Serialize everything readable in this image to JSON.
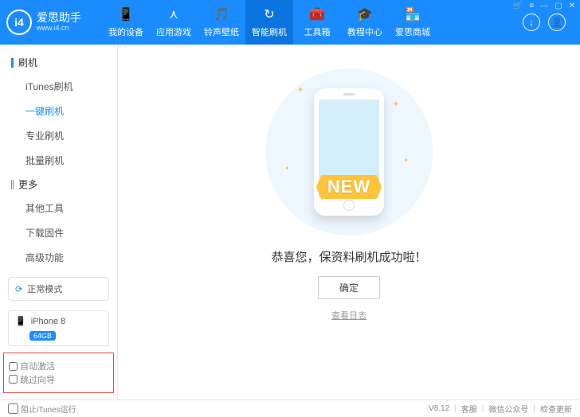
{
  "brand": {
    "logo_text": "i4",
    "name": "爱思助手",
    "url": "www.i4.cn"
  },
  "window_controls": {
    "cart": "🛒",
    "list": "≡",
    "min": "—",
    "max": "▢",
    "close": "✕"
  },
  "nav": [
    {
      "icon": "📱",
      "label": "我的设备"
    },
    {
      "icon": "⋏",
      "label": "应用游戏"
    },
    {
      "icon": "🎵",
      "label": "铃声壁纸"
    },
    {
      "icon": "↻",
      "label": "智能刷机"
    },
    {
      "icon": "🧰",
      "label": "工具箱"
    },
    {
      "icon": "🎓",
      "label": "教程中心"
    },
    {
      "icon": "🏪",
      "label": "爱思商城"
    }
  ],
  "header_right": {
    "download": "↓",
    "user": "👤"
  },
  "sidebar": {
    "sec_flash": "刷机",
    "sec_more": "更多",
    "flash_items": [
      "iTunes刷机",
      "一键刷机",
      "专业刷机",
      "批量刷机"
    ],
    "more_items": [
      "其他工具",
      "下载固件",
      "高级功能"
    ],
    "mode_icon": "⟳",
    "mode_label": "正常模式",
    "device_icon": "📱",
    "device_label": "iPhone 8",
    "device_badge": "64GB",
    "auto_activate": "自动激活",
    "skip_wizard": "跳过向导"
  },
  "main": {
    "ribbon": "NEW",
    "title": "恭喜您，保资料刷机成功啦！",
    "ok": "确定",
    "log": "查看日志"
  },
  "footer": {
    "block_itunes": "阻止iTunes运行",
    "version": "V8.12",
    "support": "客服",
    "wechat": "微信公众号",
    "update": "检查更新"
  }
}
